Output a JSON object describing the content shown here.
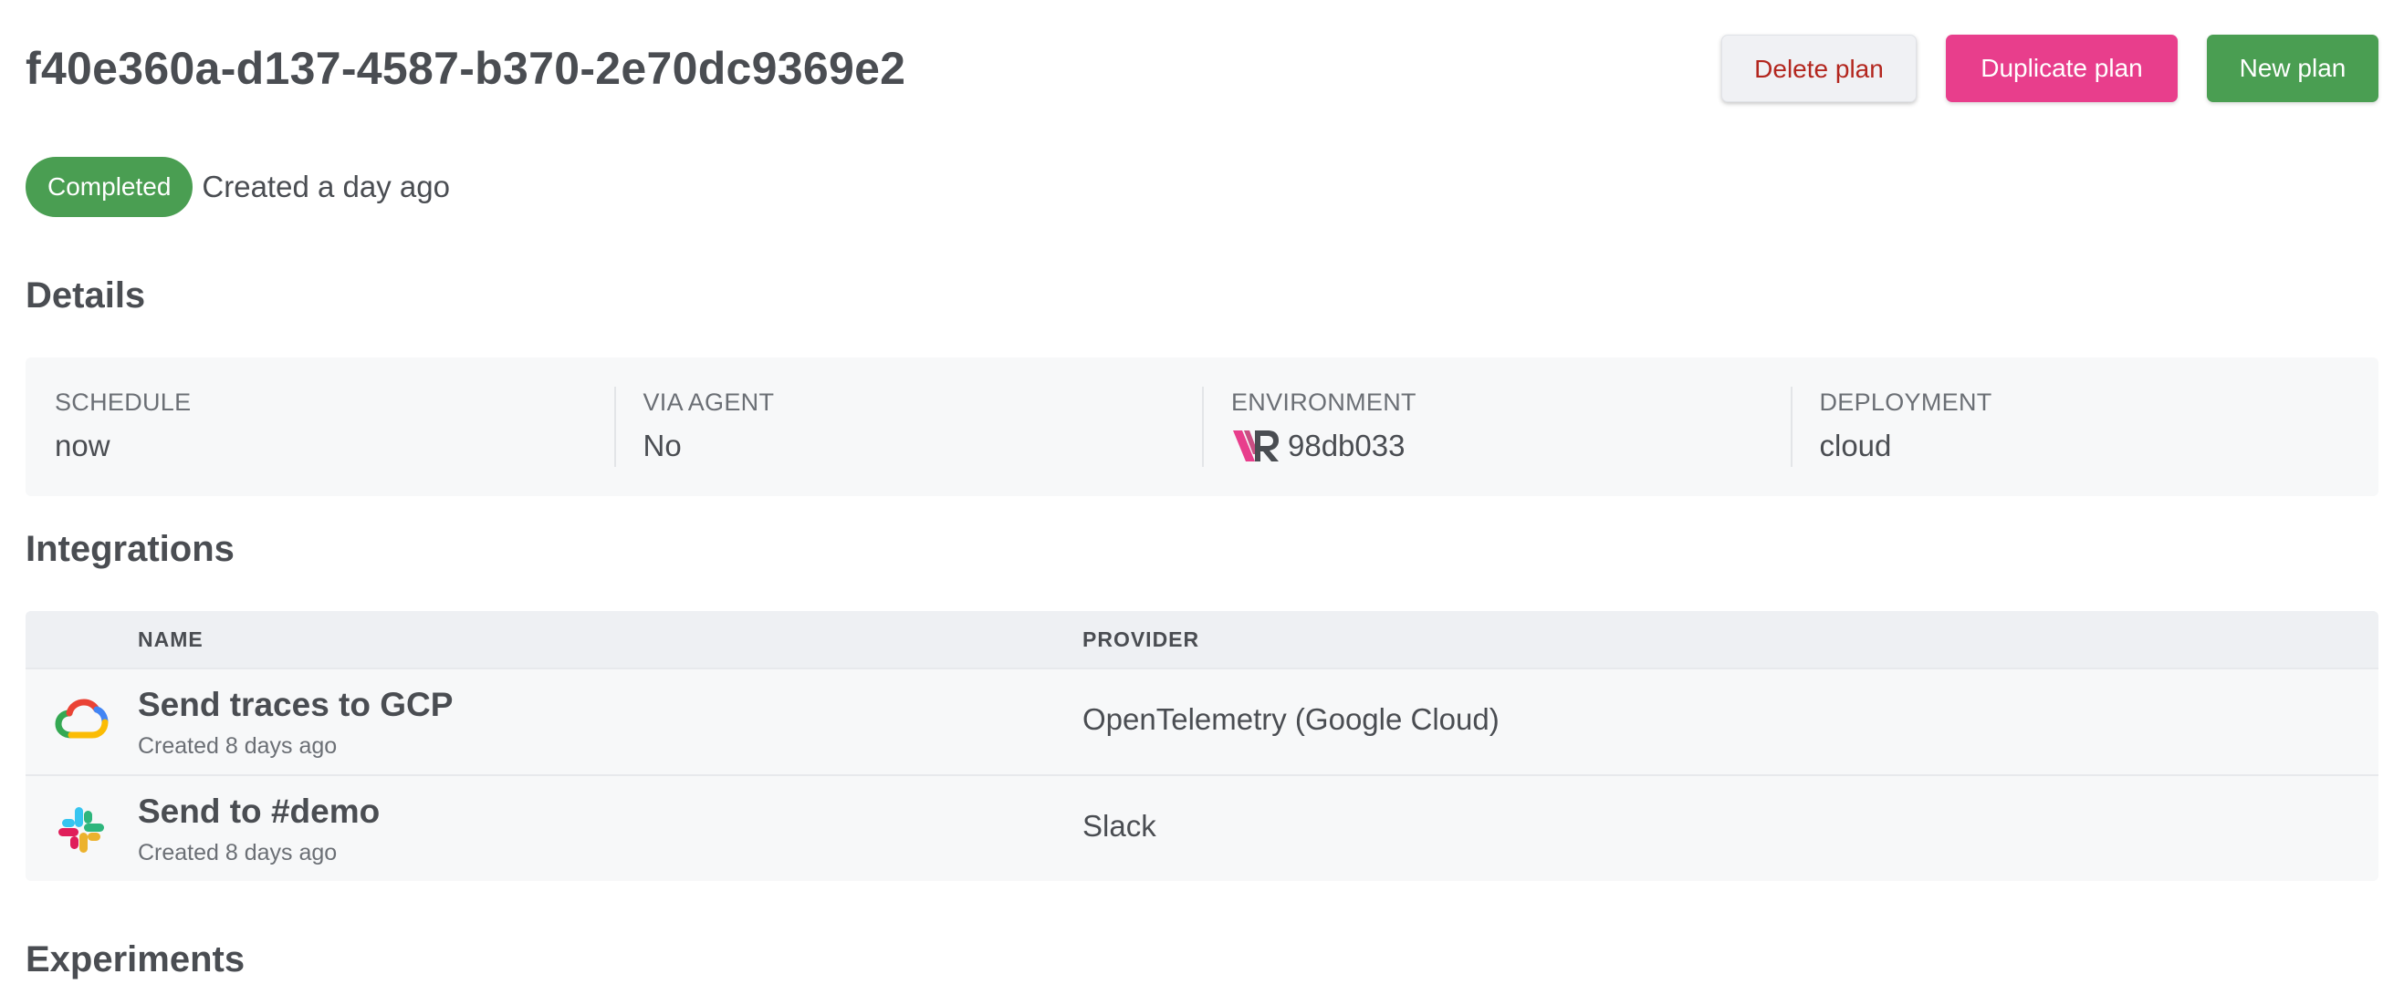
{
  "header": {
    "title": "f40e360a-d137-4587-b370-2e70dc9369e2",
    "actions": {
      "delete_label": "Delete plan",
      "duplicate_label": "Duplicate plan",
      "new_label": "New plan"
    }
  },
  "status": {
    "badge": "Completed",
    "created": "Created a day ago"
  },
  "details": {
    "heading": "Details",
    "items": [
      {
        "label": "SCHEDULE",
        "value": "now"
      },
      {
        "label": "VIA AGENT",
        "value": "No"
      },
      {
        "label": "ENVIRONMENT",
        "value": "98db033",
        "icon": "environment-logo-icon"
      },
      {
        "label": "DEPLOYMENT",
        "value": "cloud"
      }
    ]
  },
  "integrations": {
    "heading": "Integrations",
    "columns": {
      "name": "NAME",
      "provider": "PROVIDER"
    },
    "rows": [
      {
        "name": "Send traces to GCP",
        "created": "Created 8 days ago",
        "provider": "OpenTelemetry (Google Cloud)",
        "icon": "google-cloud-icon"
      },
      {
        "name": "Send to #demo",
        "created": "Created 8 days ago",
        "provider": "Slack",
        "icon": "slack-icon"
      }
    ]
  },
  "experiments": {
    "heading": "Experiments"
  },
  "colors": {
    "text": "#4a4d52",
    "muted": "#6b6f75",
    "success": "#4a9e52",
    "accent_pink": "#e83e8c",
    "danger": "#b3261e",
    "panel": "#f7f8f9"
  }
}
